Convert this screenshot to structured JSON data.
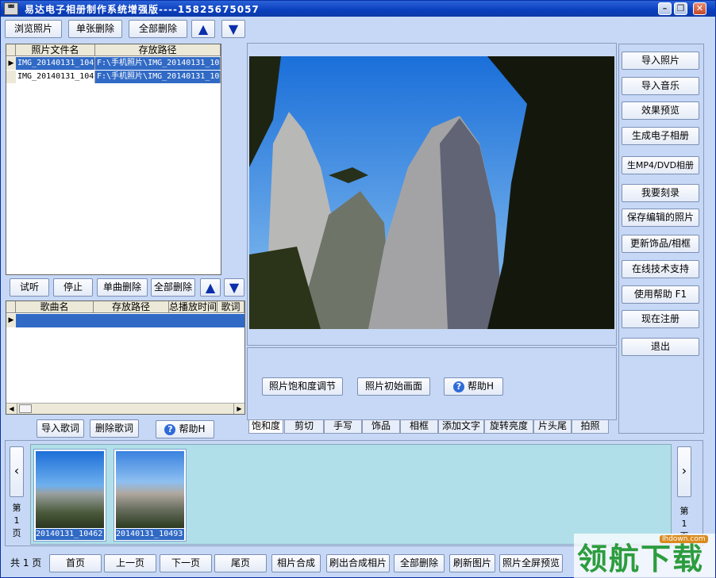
{
  "window": {
    "app_icon_text": "ᄈ",
    "title": "易达电子相册制作系统增强版----15825675057"
  },
  "photo_toolbar": {
    "browse": "浏览照片",
    "delete_one": "单张删除",
    "delete_all": "全部删除"
  },
  "photo_grid": {
    "headers": [
      "照片文件名",
      "存放路径"
    ],
    "rows": [
      {
        "name": "IMG_20140131_104",
        "path": "F:\\手机照片\\IMG_20140131_10"
      },
      {
        "name": "IMG_20140131_104",
        "path": "F:\\手机照片\\IMG_20140131_10"
      }
    ]
  },
  "music_toolbar": {
    "listen": "试听",
    "stop": "停止",
    "delete_one": "单曲删除",
    "delete_all": "全部删除"
  },
  "music_grid": {
    "headers": [
      "歌曲名",
      "存放路径",
      "总播放时间",
      "歌词"
    ]
  },
  "lyrics": {
    "import": "导入歌词",
    "delete": "删除歌词",
    "help": "帮助H"
  },
  "preview_panel": {
    "saturation_adjust": "照片饱和度调节",
    "initial_view": "照片初始画面",
    "help": "帮助H"
  },
  "edit_tabs": [
    "饱和度",
    "剪切",
    "手写",
    "饰品",
    "相框",
    "添加文字",
    "旋转亮度",
    "片头尾",
    "拍照"
  ],
  "right_menu": [
    "导入照片",
    "导入音乐",
    "效果预览",
    "生成电子相册",
    "生MP4/DVD相册",
    "我要刻录",
    "保存编辑的照片",
    "更新饰品/相框",
    "在线技术支持",
    "使用帮助  F1",
    "现在注册",
    "退出"
  ],
  "pager": {
    "left_label": "第\n1\n页",
    "right_label": "第\n1\n页",
    "total": "共 1 页"
  },
  "thumbs": [
    {
      "caption": "20140131_10462"
    },
    {
      "caption": "20140131_10493"
    }
  ],
  "bottom_buttons": [
    "首页",
    "上一页",
    "下一页",
    "尾页",
    "相片合成",
    "刷出合成相片",
    "全部删除",
    "刷新图片",
    "照片全屏预览"
  ],
  "watermark": {
    "text": "领航下载",
    "url": "lhdown.com"
  }
}
